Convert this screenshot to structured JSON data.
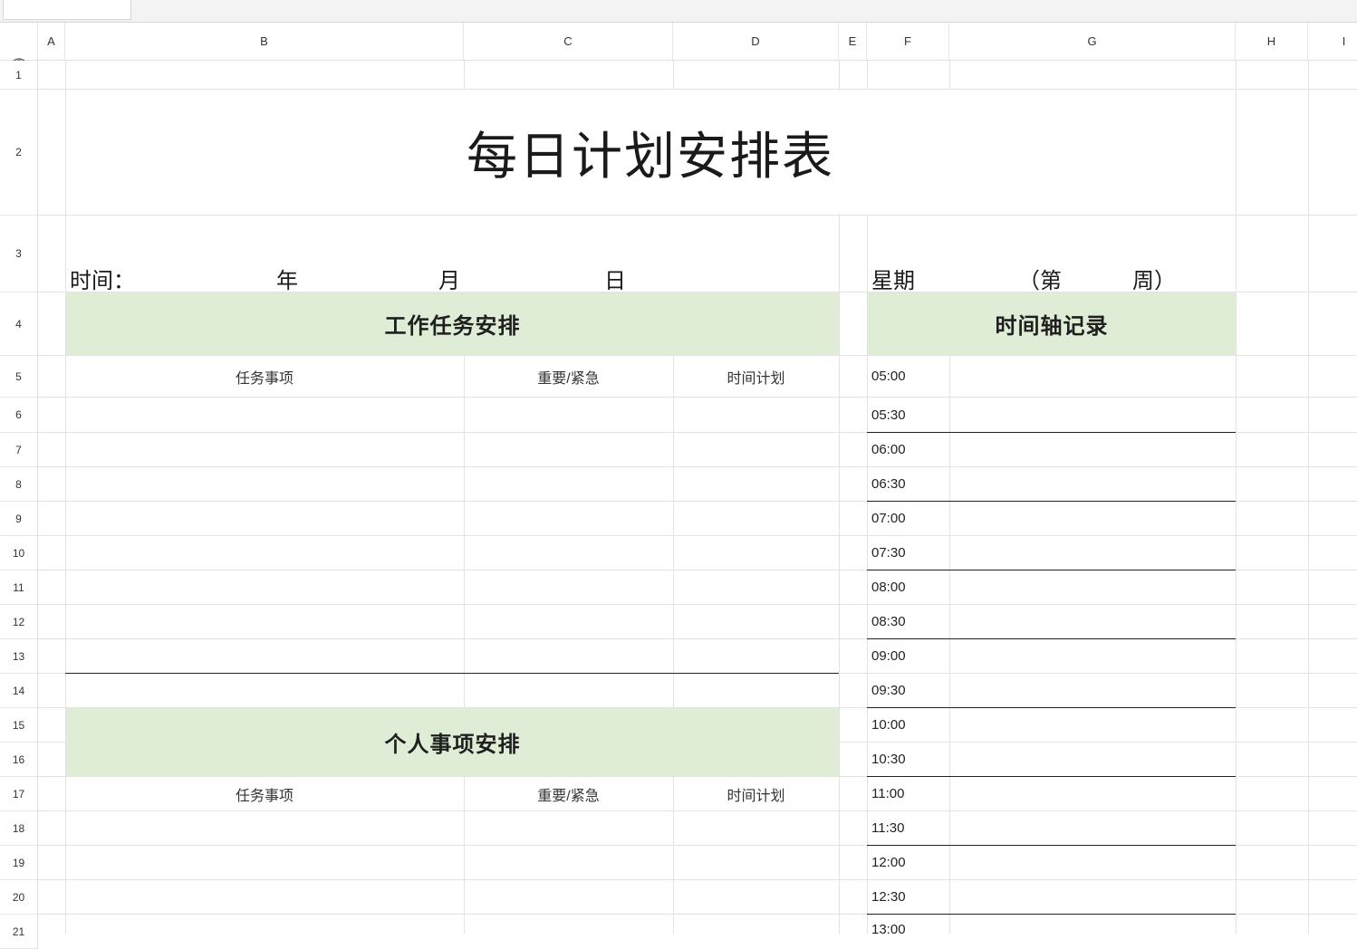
{
  "columns": [
    "A",
    "B",
    "C",
    "D",
    "E",
    "F",
    "G",
    "H",
    "I"
  ],
  "rows": [
    "1",
    "2",
    "3",
    "4",
    "5",
    "6",
    "7",
    "8",
    "9",
    "10",
    "11",
    "12",
    "13",
    "14",
    "15",
    "16",
    "17",
    "18",
    "19",
    "20",
    "21"
  ],
  "title": "每日计划安排表",
  "date_row": {
    "time_label": "时间：",
    "year": "年",
    "month": "月",
    "day": "日",
    "weekday": "星期",
    "week_open": "（第",
    "week_close": "周）"
  },
  "work_section": {
    "header": "工作任务安排",
    "col_task": "任务事项",
    "col_priority": "重要/紧急",
    "col_plan": "时间计划"
  },
  "personal_section": {
    "header": "个人事项安排",
    "col_task": "任务事项",
    "col_priority": "重要/紧急",
    "col_plan": "时间计划"
  },
  "timeline": {
    "header": "时间轴记录",
    "times": [
      "05:00",
      "05:30",
      "06:00",
      "06:30",
      "07:00",
      "07:30",
      "08:00",
      "08:30",
      "09:00",
      "09:30",
      "10:00",
      "10:30",
      "11:00",
      "11:30",
      "12:00",
      "12:30",
      "13:00"
    ]
  },
  "icons": {
    "visibility": "eye-icon"
  }
}
